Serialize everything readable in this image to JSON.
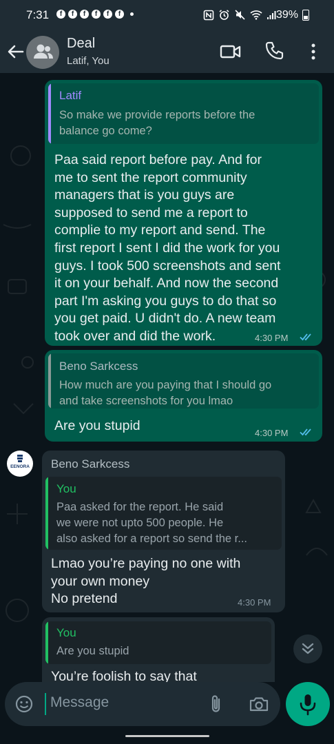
{
  "status": {
    "time": "7:31",
    "battery": "39%",
    "notification_icons": [
      "facebook-icon",
      "facebook-icon",
      "facebook-icon",
      "facebook-icon",
      "facebook-icon",
      "facebook-icon"
    ]
  },
  "header": {
    "title": "Deal",
    "subtitle": "Latif, You",
    "icons": [
      "back-arrow-icon",
      "group-avatar-icon",
      "video-call-icon",
      "phone-icon",
      "more-vert-icon"
    ]
  },
  "messages": [
    {
      "direction": "outgoing",
      "quote": {
        "name": "Latif",
        "name_color": "#a18aff",
        "text": [
          "So make we provide reports before the",
          "balance go come?"
        ]
      },
      "body": [
        "Paa said report before pay. And for",
        "me to sent the report community",
        "managers that is you guys are",
        "supposed to send me a report to",
        "complie to my report and send. The",
        "first report I sent I did the work for you",
        "guys. I took 500 screenshots and sent",
        "it on your behalf. And now the second",
        "part I'm asking you guys to do that so",
        "you get paid. U didn't do. A new team",
        "took over and did the work."
      ],
      "time": "4:30 PM",
      "read": true
    },
    {
      "direction": "outgoing",
      "quote": {
        "name": "Beno Sarkcess",
        "name_color": "#aebac1",
        "text": [
          "How much are you paying that I should go",
          "and take screenshots for you lmao"
        ]
      },
      "body": [
        "Are you stupid"
      ],
      "time": "4:30 PM",
      "read": true
    },
    {
      "direction": "incoming",
      "sender": "Beno Sarkcess",
      "avatar_text": "EENORA",
      "quote": {
        "name": "You",
        "name_color": "#21c063",
        "text": [
          "Paa asked for the report. He said",
          "we were not upto 500 people. He",
          "also asked for a report so send the r..."
        ]
      },
      "body": [
        "Lmao you’re paying no one with",
        "your own money",
        "No pretend"
      ],
      "time": "4:30 PM"
    },
    {
      "direction": "incoming",
      "quote": {
        "name": "You",
        "name_color": "#21c063",
        "text": [
          "Are you stupid"
        ]
      },
      "body": [
        "You’re foolish to say that"
      ]
    }
  ],
  "composer": {
    "placeholder": "Message",
    "icons": [
      "emoji-icon",
      "attach-icon",
      "camera-icon",
      "mic-icon"
    ]
  },
  "colors": {
    "outgoing_bubble": "#005c4b",
    "incoming_bubble": "#202c33",
    "accent": "#00a884",
    "read_ticks": "#53bdeb"
  }
}
